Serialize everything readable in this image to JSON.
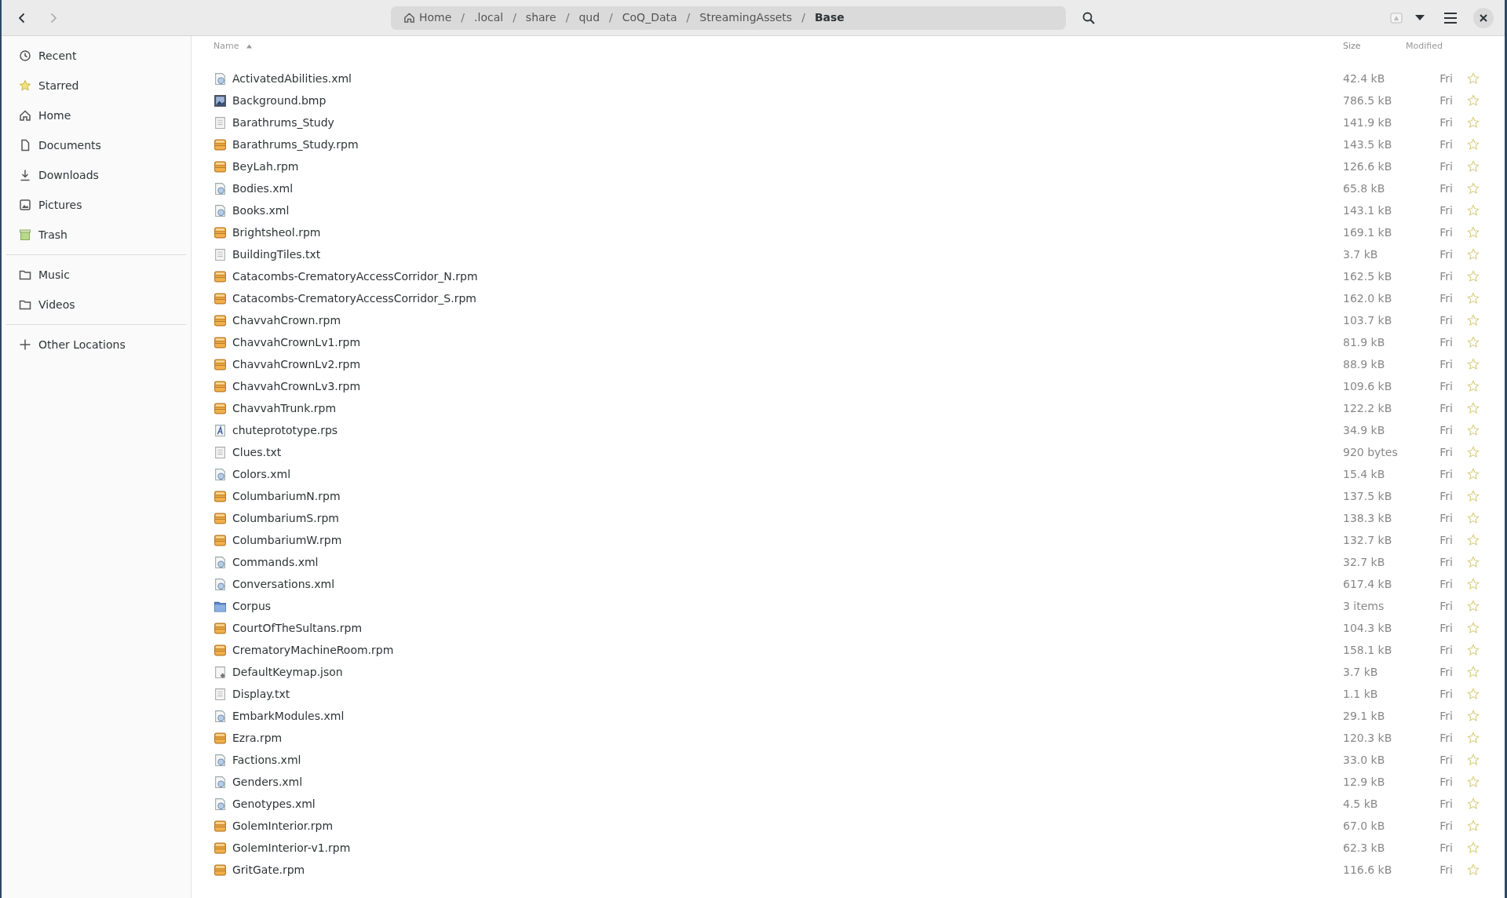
{
  "path_bar": [
    {
      "kind": "home",
      "label": "Home",
      "selected": false
    },
    {
      "kind": "separator",
      "label": "/"
    },
    {
      "kind": "segment",
      "label": ".local",
      "selected": false
    },
    {
      "kind": "separator",
      "label": "/"
    },
    {
      "kind": "segment",
      "label": "share",
      "selected": false
    },
    {
      "kind": "separator",
      "label": "/"
    },
    {
      "kind": "segment",
      "label": "qud",
      "selected": false
    },
    {
      "kind": "separator",
      "label": "/"
    },
    {
      "kind": "segment",
      "label": "CoQ_Data",
      "selected": false
    },
    {
      "kind": "separator",
      "label": "/"
    },
    {
      "kind": "segment",
      "label": "StreamingAssets",
      "selected": false
    },
    {
      "kind": "separator",
      "label": "/"
    },
    {
      "kind": "segment",
      "label": "Base",
      "selected": true
    }
  ],
  "sidebar": [
    {
      "kind": "recent",
      "label": "Recent"
    },
    {
      "kind": "starred",
      "label": "Starred"
    },
    {
      "kind": "home",
      "label": "Home"
    },
    {
      "kind": "documents",
      "label": "Documents"
    },
    {
      "kind": "downloads",
      "label": "Downloads"
    },
    {
      "kind": "pictures",
      "label": "Pictures"
    },
    {
      "kind": "trash",
      "label": "Trash"
    },
    {
      "kind": "divider"
    },
    {
      "kind": "folder",
      "label": "Music"
    },
    {
      "kind": "folder",
      "label": "Videos"
    },
    {
      "kind": "divider"
    },
    {
      "kind": "add",
      "label": "Other Locations"
    }
  ],
  "columns": [
    {
      "kind": "name",
      "label": "Name",
      "sorted": true
    },
    {
      "kind": "size",
      "label": "Size",
      "sorted": false
    },
    {
      "kind": "modified",
      "label": "Modified",
      "sorted": false
    }
  ],
  "files": [
    {
      "kind": "xml",
      "name": "ActivatedAbilities.xml",
      "size": "42.4 kB",
      "modified": "Fri",
      "starred": false
    },
    {
      "kind": "image",
      "name": "Background.bmp",
      "size": "786.5 kB",
      "modified": "Fri",
      "starred": false
    },
    {
      "kind": "text",
      "name": "Barathrums_Study",
      "size": "141.9 kB",
      "modified": "Fri",
      "starred": false
    },
    {
      "kind": "package",
      "name": "Barathrums_Study.rpm",
      "size": "143.5 kB",
      "modified": "Fri",
      "starred": false
    },
    {
      "kind": "package",
      "name": "BeyLah.rpm",
      "size": "126.6 kB",
      "modified": "Fri",
      "starred": false
    },
    {
      "kind": "xml",
      "name": "Bodies.xml",
      "size": "65.8 kB",
      "modified": "Fri",
      "starred": false
    },
    {
      "kind": "xml",
      "name": "Books.xml",
      "size": "143.1 kB",
      "modified": "Fri",
      "starred": false
    },
    {
      "kind": "package",
      "name": "Brightsheol.rpm",
      "size": "169.1 kB",
      "modified": "Fri",
      "starred": false
    },
    {
      "kind": "text",
      "name": "BuildingTiles.txt",
      "size": "3.7 kB",
      "modified": "Fri",
      "starred": false
    },
    {
      "kind": "package",
      "name": "Catacombs-CrematoryAccessCorridor_N.rpm",
      "size": "162.5 kB",
      "modified": "Fri",
      "starred": false
    },
    {
      "kind": "package",
      "name": "Catacombs-CrematoryAccessCorridor_S.rpm",
      "size": "162.0 kB",
      "modified": "Fri",
      "starred": false
    },
    {
      "kind": "package",
      "name": "ChavvahCrown.rpm",
      "size": "103.7 kB",
      "modified": "Fri",
      "starred": false
    },
    {
      "kind": "package",
      "name": "ChavvahCrownLv1.rpm",
      "size": "81.9 kB",
      "modified": "Fri",
      "starred": false
    },
    {
      "kind": "package",
      "name": "ChavvahCrownLv2.rpm",
      "size": "88.9 kB",
      "modified": "Fri",
      "starred": false
    },
    {
      "kind": "package",
      "name": "ChavvahCrownLv3.rpm",
      "size": "109.6 kB",
      "modified": "Fri",
      "starred": false
    },
    {
      "kind": "package",
      "name": "ChavvahTrunk.rpm",
      "size": "122.2 kB",
      "modified": "Fri",
      "starred": false
    },
    {
      "kind": "font",
      "name": "chuteprototype.rps",
      "size": "34.9 kB",
      "modified": "Fri",
      "starred": false
    },
    {
      "kind": "text",
      "name": "Clues.txt",
      "size": "920 bytes",
      "modified": "Fri",
      "starred": false
    },
    {
      "kind": "xml",
      "name": "Colors.xml",
      "size": "15.4 kB",
      "modified": "Fri",
      "starred": false
    },
    {
      "kind": "package",
      "name": "ColumbariumN.rpm",
      "size": "137.5 kB",
      "modified": "Fri",
      "starred": false
    },
    {
      "kind": "package",
      "name": "ColumbariumS.rpm",
      "size": "138.3 kB",
      "modified": "Fri",
      "starred": false
    },
    {
      "kind": "package",
      "name": "ColumbariumW.rpm",
      "size": "132.7 kB",
      "modified": "Fri",
      "starred": false
    },
    {
      "kind": "xml",
      "name": "Commands.xml",
      "size": "32.7 kB",
      "modified": "Fri",
      "starred": false
    },
    {
      "kind": "xml",
      "name": "Conversations.xml",
      "size": "617.4 kB",
      "modified": "Fri",
      "starred": false
    },
    {
      "kind": "folder",
      "name": "Corpus",
      "size": "3 items",
      "modified": "Fri",
      "starred": false
    },
    {
      "kind": "package",
      "name": "CourtOfTheSultans.rpm",
      "size": "104.3 kB",
      "modified": "Fri",
      "starred": false
    },
    {
      "kind": "package",
      "name": "CrematoryMachineRoom.rpm",
      "size": "158.1 kB",
      "modified": "Fri",
      "starred": false
    },
    {
      "kind": "json",
      "name": "DefaultKeymap.json",
      "size": "3.7 kB",
      "modified": "Fri",
      "starred": false
    },
    {
      "kind": "text",
      "name": "Display.txt",
      "size": "1.1 kB",
      "modified": "Fri",
      "starred": false
    },
    {
      "kind": "xml",
      "name": "EmbarkModules.xml",
      "size": "29.1 kB",
      "modified": "Fri",
      "starred": false
    },
    {
      "kind": "package",
      "name": "Ezra.rpm",
      "size": "120.3 kB",
      "modified": "Fri",
      "starred": false
    },
    {
      "kind": "xml",
      "name": "Factions.xml",
      "size": "33.0 kB",
      "modified": "Fri",
      "starred": false
    },
    {
      "kind": "xml",
      "name": "Genders.xml",
      "size": "12.9 kB",
      "modified": "Fri",
      "starred": false
    },
    {
      "kind": "xml",
      "name": "Genotypes.xml",
      "size": "4.5 kB",
      "modified": "Fri",
      "starred": false
    },
    {
      "kind": "package",
      "name": "GolemInterior.rpm",
      "size": "67.0 kB",
      "modified": "Fri",
      "starred": false
    },
    {
      "kind": "package",
      "name": "GolemInterior-v1.rpm",
      "size": "62.3 kB",
      "modified": "Fri",
      "starred": false
    },
    {
      "kind": "package",
      "name": "GritGate.rpm",
      "size": "116.6 kB",
      "modified": "Fri",
      "starred": false
    }
  ]
}
